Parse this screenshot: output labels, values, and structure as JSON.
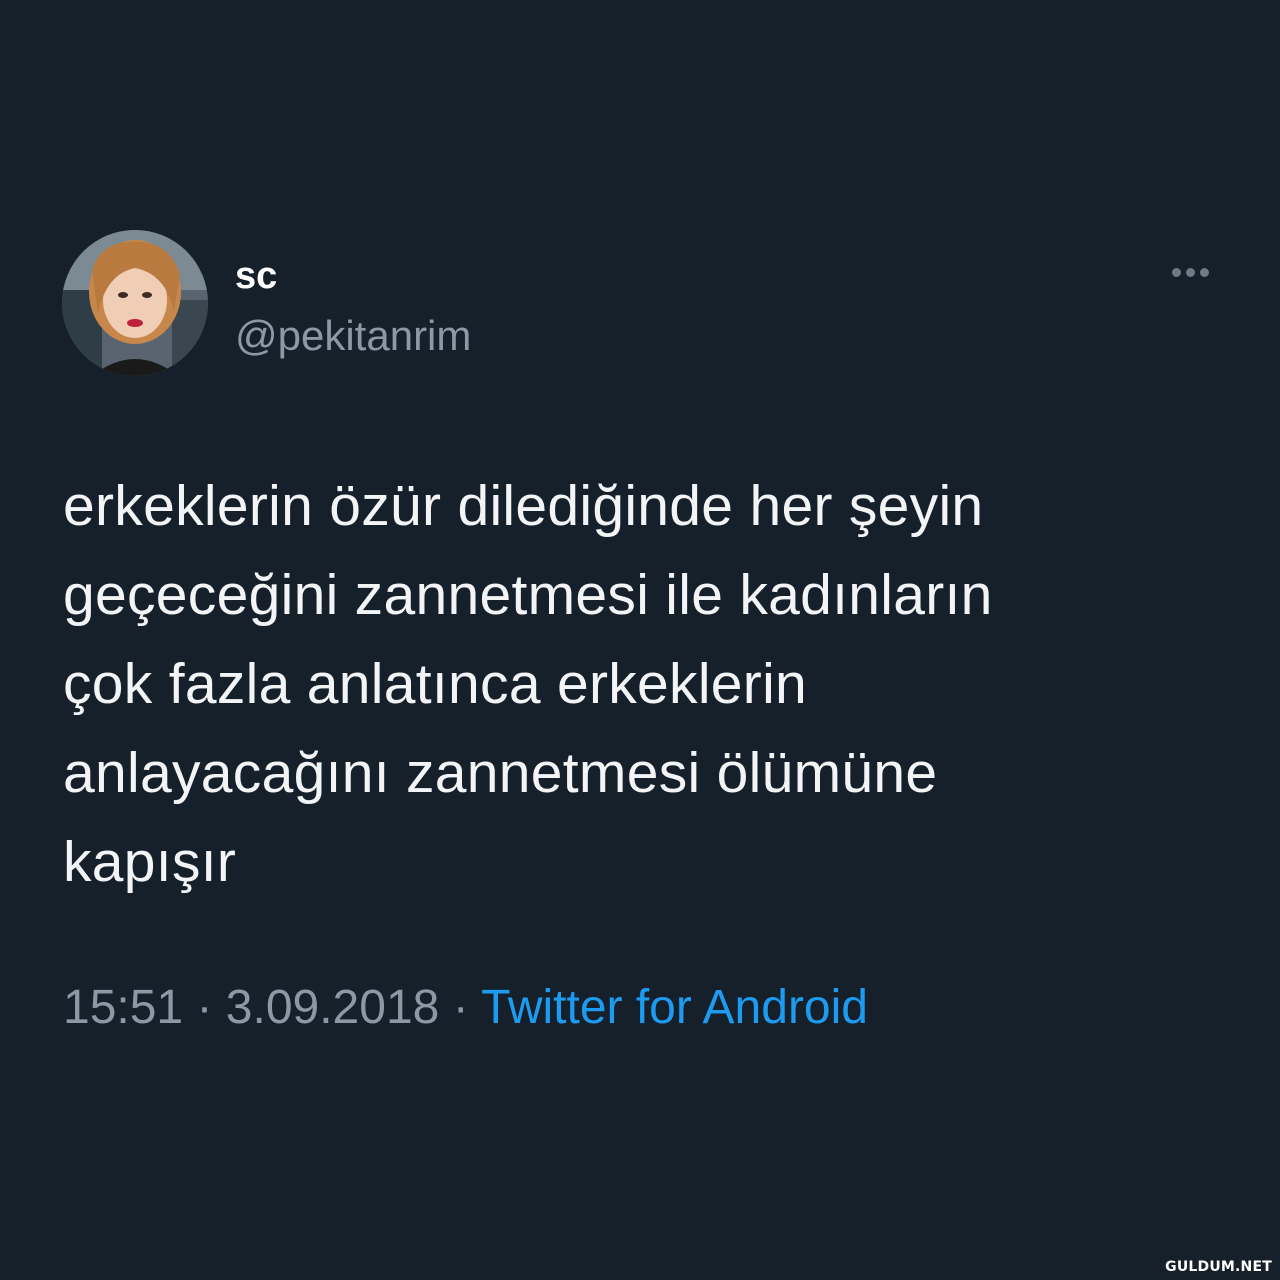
{
  "user": {
    "display_name": "sc",
    "handle": "@pekitanrim",
    "avatar_icon": "profile-photo"
  },
  "more_icon": "more-horizontal-icon",
  "tweet": {
    "lines": [
      "erkeklerin özür dilediğinde her şeyin",
      "geçeceğini zannetmesi ile kadınların",
      "çok fazla anlatınca erkeklerin",
      "anlayacağını zannetmesi ölümüne",
      "kapışır"
    ]
  },
  "meta": {
    "time": "15:51",
    "separator": "·",
    "date": "3.09.2018",
    "source": "Twitter for Android"
  },
  "watermark": "GULDUM.NET",
  "colors": {
    "background": "#16202b",
    "text": "#f2f4f6",
    "muted": "#8b98a5",
    "link": "#1d9bf0"
  }
}
